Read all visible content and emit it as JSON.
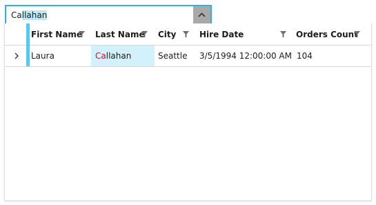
{
  "combo": {
    "match_text": "Ca",
    "highlighted_text": "llahan"
  },
  "grid": {
    "columns": [
      {
        "label": "First Name"
      },
      {
        "label": "Last Name"
      },
      {
        "label": "City"
      },
      {
        "label": "Hire Date"
      },
      {
        "label": "Orders Count"
      }
    ],
    "rows": [
      {
        "first_name": "Laura",
        "last_name_match": "Ca",
        "last_name_rest": "llahan",
        "city": "Seattle",
        "hire_date": "3/5/1994 12:00:00 AM",
        "orders_count": "104"
      }
    ]
  },
  "colors": {
    "accent": "#2cb5dc",
    "selection": "#d3f1fa",
    "match": "#c8102e"
  },
  "icons": {
    "dropdown": "chevron-up-icon",
    "filter": "filter-icon",
    "expand": "chevron-right-icon"
  }
}
